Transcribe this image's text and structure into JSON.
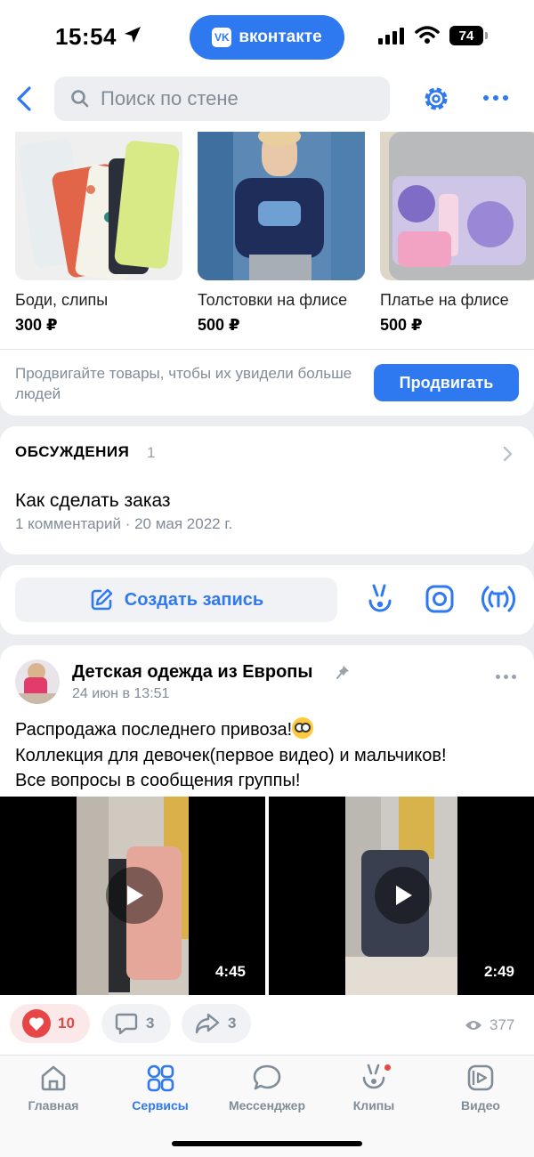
{
  "status_bar": {
    "time": "15:54",
    "app_pill": "вконтакте",
    "battery": "74"
  },
  "navbar": {
    "search_placeholder": "Поиск по стене"
  },
  "products": {
    "items": [
      {
        "name": "Боди, слипы",
        "price": "300 ₽"
      },
      {
        "name": "Толстовки на флисе",
        "price": "500 ₽"
      },
      {
        "name": "Платье на флисе",
        "price": "500 ₽"
      }
    ],
    "promo_text": "Продвигайте товары, чтобы их увидели больше людей",
    "promo_button": "Продвигать"
  },
  "discussions": {
    "header": "ОБСУЖДЕНИЯ",
    "count": "1",
    "topic_title": "Как сделать заказ",
    "topic_meta": "1 комментарий · 20 мая 2022 г."
  },
  "create_post": {
    "label": "Создать запись"
  },
  "post": {
    "author": "Детская одежда из Европы",
    "date": "24 июн в 13:51",
    "text_line1": "Распродажа последнего привоза!",
    "text_line2": "Коллекция для девочек(первое видео) и мальчиков!",
    "text_line3": "Все вопросы в сообщения группы!",
    "videos": [
      {
        "duration": "4:45"
      },
      {
        "duration": "2:49"
      }
    ],
    "likes": "10",
    "comments": "3",
    "reposts": "3",
    "views": "377"
  },
  "tabbar": {
    "tabs": [
      {
        "label": "Главная"
      },
      {
        "label": "Сервисы"
      },
      {
        "label": "Мессенджер"
      },
      {
        "label": "Клипы"
      },
      {
        "label": "Видео"
      }
    ]
  },
  "colors": {
    "accent": "#2e78f0",
    "like_red": "#e64646",
    "secondary_text": "#818c99"
  }
}
